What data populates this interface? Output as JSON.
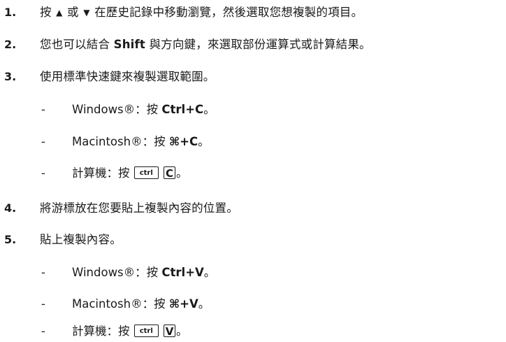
{
  "steps": [
    {
      "num": "1.",
      "p1": "按 ",
      "up_arrow": "▲",
      "p2": " 或 ",
      "down_arrow": "▼",
      "p3": " 在歷史記錄中移動瀏覽，然後選取您想複製的項目。"
    },
    {
      "num": "2.",
      "p1": "您也可以結合 ",
      "bold": "Shift",
      "p2": " 與方向鍵，來選取部份運算式或計算結果。"
    },
    {
      "num": "3.",
      "text": "使用標準快速鍵來複製選取範圍。",
      "sub": [
        {
          "dash": "-",
          "prefix": "Windows®：按 ",
          "shortcut": "Ctrl+C",
          "suffix": "。"
        },
        {
          "dash": "-",
          "prefix": "Macintosh®：按 ",
          "shortcut": "⌘+C",
          "suffix": "。"
        },
        {
          "dash": "-",
          "prefix": "計算機：按 ",
          "key1": "ctrl",
          "key2": "C",
          "suffix": "。"
        }
      ]
    },
    {
      "num": "4.",
      "text": "將游標放在您要貼上複製內容的位置。"
    },
    {
      "num": "5.",
      "text": "貼上複製內容。",
      "sub": [
        {
          "dash": "-",
          "prefix": "Windows®：按 ",
          "shortcut": "Ctrl+V",
          "suffix": "。"
        },
        {
          "dash": "-",
          "prefix": "Macintosh®：按 ",
          "shortcut": "⌘+V",
          "suffix": "。"
        },
        {
          "dash": "-",
          "prefix": "計算機：按 ",
          "key1": "ctrl",
          "key2": "V",
          "suffix": "。"
        }
      ]
    }
  ]
}
